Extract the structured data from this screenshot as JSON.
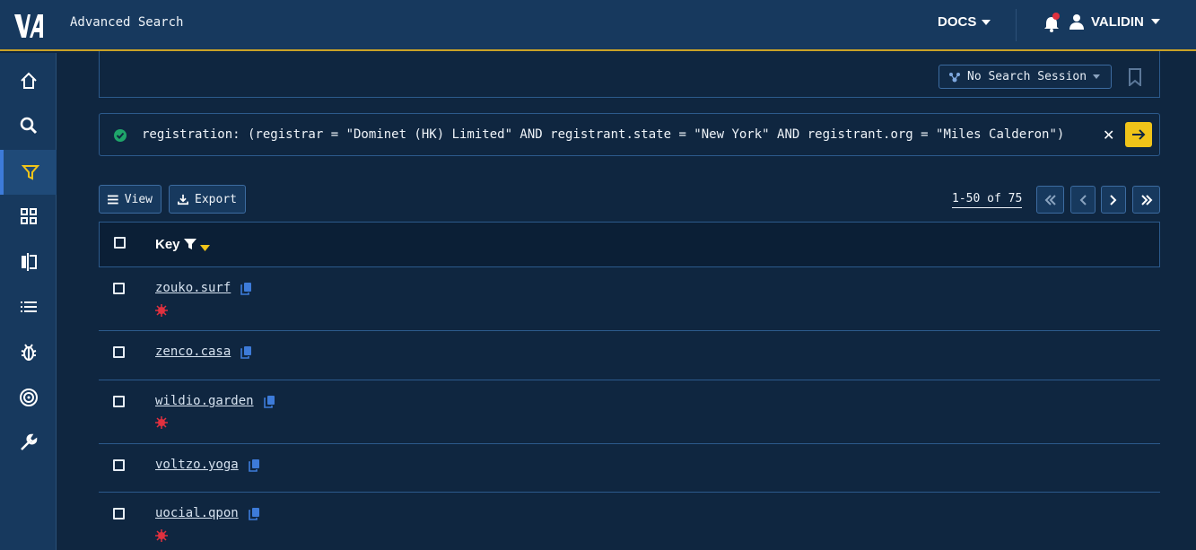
{
  "app": {
    "logo": "V4",
    "title": "Advanced Search"
  },
  "header": {
    "docs_label": "DOCS",
    "user_label": "VALIDIN",
    "has_notification": true
  },
  "sidebar": {
    "items": [
      {
        "icon": "home-icon"
      },
      {
        "icon": "search-icon"
      },
      {
        "icon": "filter-icon",
        "active": true
      },
      {
        "icon": "grid-icon"
      },
      {
        "icon": "compare-icon"
      },
      {
        "icon": "list-icon"
      },
      {
        "icon": "bug-icon"
      },
      {
        "icon": "target-icon"
      },
      {
        "icon": "wrench-icon"
      }
    ]
  },
  "session": {
    "label": "No Search Session"
  },
  "query": {
    "text": "registration: (registrar = \"Dominet (HK) Limited\" AND registrant.state = \"New York\" AND registrant.org = \"Miles Calderon\")",
    "clear": "✕"
  },
  "toolbar": {
    "view_label": "View",
    "export_label": "Export"
  },
  "pagination": {
    "info": "1-50 of 75"
  },
  "table": {
    "key_header": "Key",
    "rows": [
      {
        "domain": "zouko.surf",
        "flagged": true
      },
      {
        "domain": "zenco.casa",
        "flagged": false
      },
      {
        "domain": "wildio.garden",
        "flagged": true
      },
      {
        "domain": "voltzo.yoga",
        "flagged": false
      },
      {
        "domain": "uocial.qpon",
        "flagged": true
      }
    ]
  },
  "colors": {
    "accent": "#f0c419",
    "link": "#3d7bd9",
    "threat": "#e0313f",
    "bg": "#0f2640",
    "header": "#17395e"
  }
}
